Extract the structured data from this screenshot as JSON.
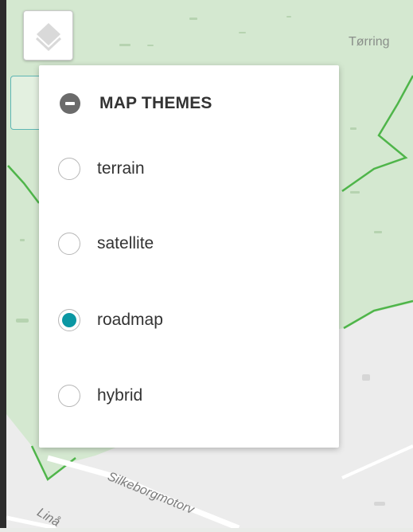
{
  "map": {
    "town_label": "Tørring",
    "road_label": "Silkeborgmotorv",
    "road_label_2": "Linå",
    "colors": {
      "green_area": "#d3e7d0",
      "boundary": "#4fb54a",
      "land": "#ececec"
    }
  },
  "controls": {
    "layers_icon": "layers-icon"
  },
  "panel": {
    "title": "MAP THEMES",
    "collapse_icon": "minus-circle-icon",
    "accent_color": "#0b97a3",
    "selected": "roadmap",
    "options": [
      {
        "label": "terrain",
        "checked": false
      },
      {
        "label": "satellite",
        "checked": false
      },
      {
        "label": "roadmap",
        "checked": true
      },
      {
        "label": "hybrid",
        "checked": false
      }
    ]
  }
}
